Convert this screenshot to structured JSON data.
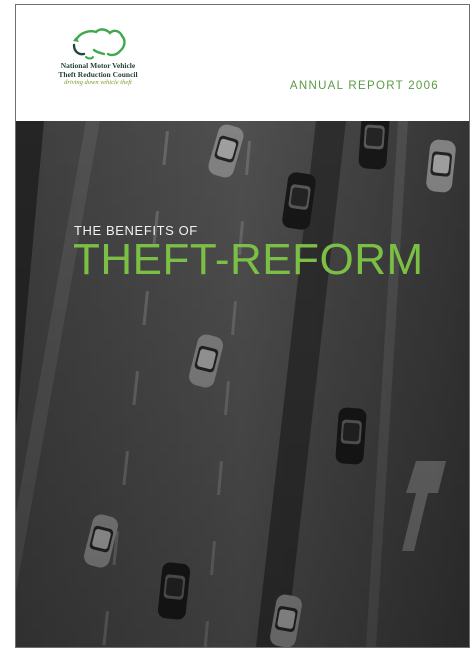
{
  "organization": {
    "name_line1": "National Motor Vehicle",
    "name_line2": "Theft Reduction Council",
    "tagline": "driving down vehicle theft",
    "logo_icon": "australia-outline-icon"
  },
  "header": {
    "report_title": "ANNUAL REPORT 2006"
  },
  "cover": {
    "subtitle": "THE BENEFITS OF",
    "title": "THEFT-REFORM",
    "background_icon": "aerial-traffic-photo"
  },
  "colors": {
    "accent_green": "#7bbf44",
    "report_title_green": "#5a9a44",
    "logo_dark_green": "#1f3f35"
  }
}
